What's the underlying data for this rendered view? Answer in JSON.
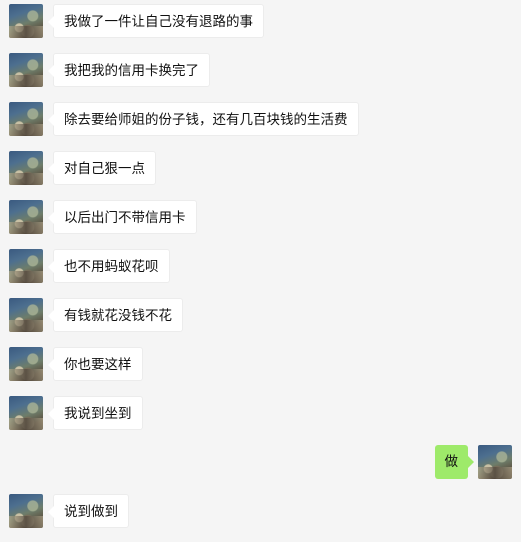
{
  "messages": [
    {
      "side": "left",
      "text": "我做了一件让自己没有退路的事"
    },
    {
      "side": "left",
      "text": "我把我的信用卡换完了"
    },
    {
      "side": "left",
      "text": "除去要给师姐的份子钱，还有几百块钱的生活费"
    },
    {
      "side": "left",
      "text": "对自己狠一点"
    },
    {
      "side": "left",
      "text": "以后出门不带信用卡"
    },
    {
      "side": "left",
      "text": "也不用蚂蚁花呗"
    },
    {
      "side": "left",
      "text": "有钱就花没钱不花"
    },
    {
      "side": "left",
      "text": "你也要这样"
    },
    {
      "side": "left",
      "text": "我说到坐到"
    },
    {
      "side": "right",
      "text": "做"
    },
    {
      "side": "left",
      "text": "说到做到"
    }
  ],
  "colors": {
    "background": "#f5f5f5",
    "incoming_bubble": "#ffffff",
    "outgoing_bubble": "#9eea6a"
  }
}
